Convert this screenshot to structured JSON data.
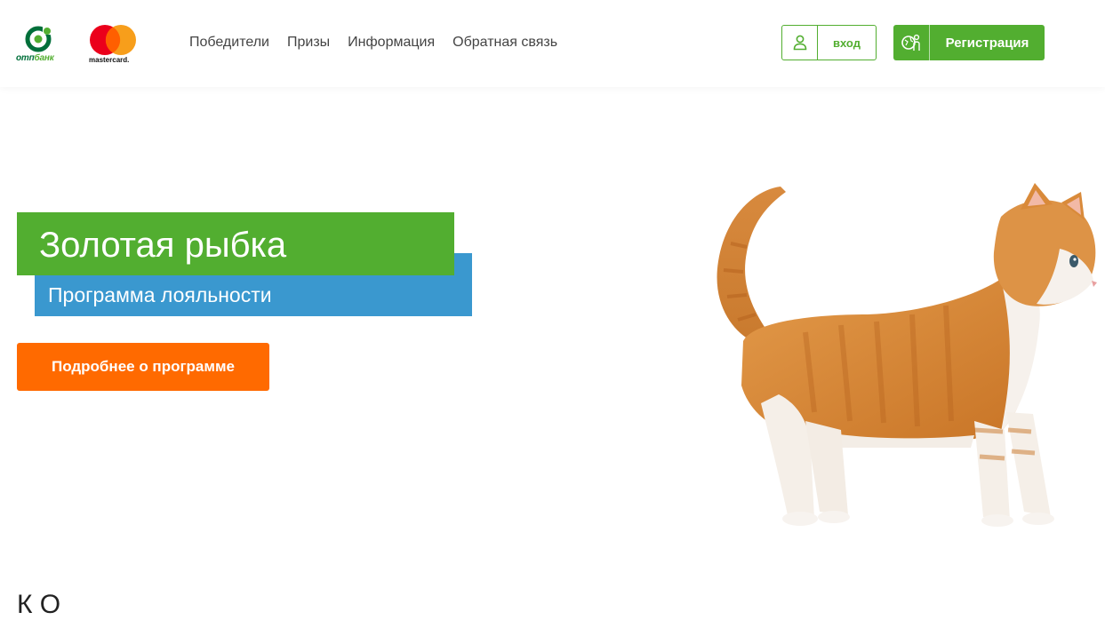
{
  "header": {
    "otp_logo": {
      "text_prefix": "отп",
      "text_suffix": "банк",
      "icon": "otp-bank-logo-icon",
      "color": "#52ae30"
    },
    "mastercard_logo": {
      "text": "mastercard.",
      "icon": "mastercard-logo-icon"
    },
    "nav": {
      "winners": "Победители",
      "prizes": "Призы",
      "info": "Информация",
      "feedback": "Обратная связь"
    },
    "login": {
      "label": "вход",
      "icon": "user-icon"
    },
    "register": {
      "label": "Регистрация",
      "icon": "register-person-icon"
    }
  },
  "hero": {
    "title": "Золотая рыбка",
    "subtitle": "Программа лояльности",
    "cta_label": "Подробнее о программе",
    "image": "orange-white-kitten",
    "colors": {
      "green": "#52ae30",
      "blue": "#3a98cf",
      "orange": "#ff6a00"
    }
  },
  "section": {
    "heading_partial": "К                                        О"
  }
}
